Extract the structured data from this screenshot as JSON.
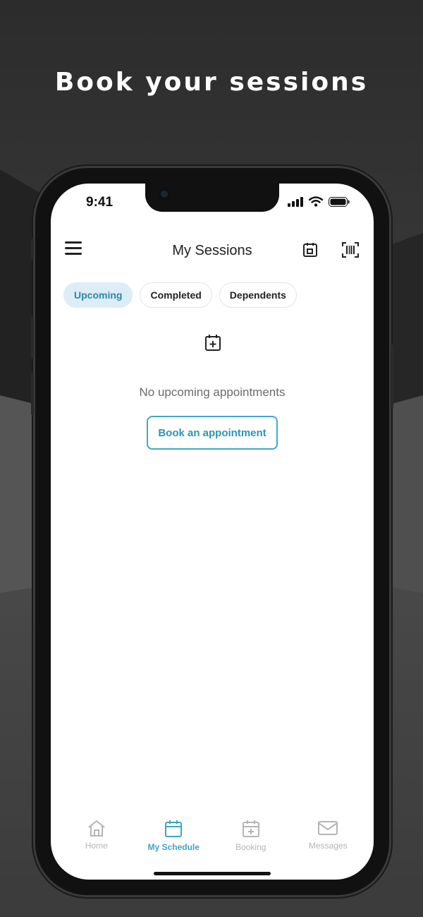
{
  "headline": "Book your sessions",
  "status": {
    "time": "9:41"
  },
  "header": {
    "title": "My Sessions",
    "icons": [
      "menu-icon",
      "calendar-icon",
      "barcode-icon"
    ]
  },
  "tabs": [
    {
      "label": "Upcoming",
      "active": true
    },
    {
      "label": "Completed",
      "active": false
    },
    {
      "label": "Dependents",
      "active": false
    }
  ],
  "empty_state": {
    "icon": "calendar-add-icon",
    "message": "No upcoming appointments",
    "button_label": "Book an appointment"
  },
  "bottom_nav": [
    {
      "label": "Home",
      "icon": "home-icon",
      "active": false
    },
    {
      "label": "My Schedule",
      "icon": "calendar-icon",
      "active": true
    },
    {
      "label": "Booking",
      "icon": "calendar-add-icon",
      "active": false
    },
    {
      "label": "Messages",
      "icon": "mail-icon",
      "active": false
    }
  ],
  "colors": {
    "accent": "#3aa5c9",
    "active_tab_bg": "#dcedf7",
    "inactive_nav": "#b5b5b5",
    "background": "#333333"
  }
}
